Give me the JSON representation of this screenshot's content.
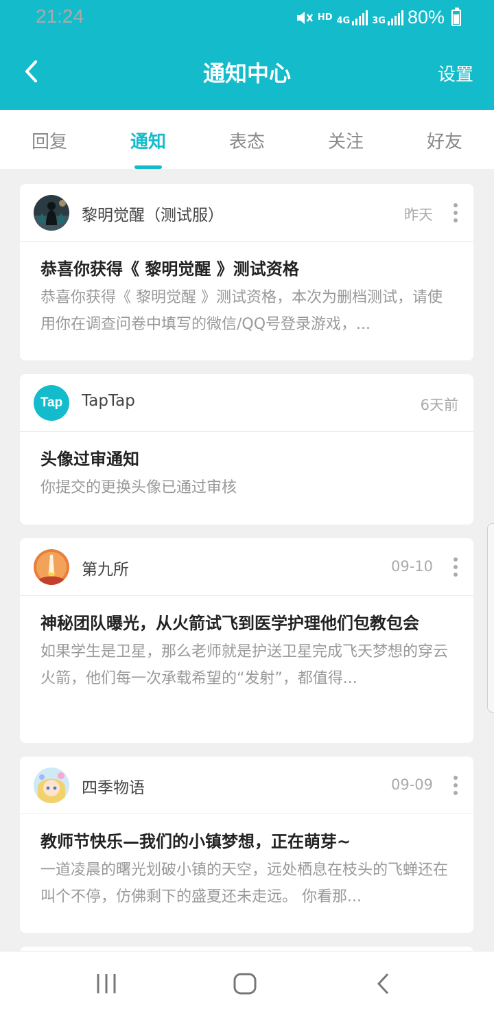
{
  "status_bar": {
    "time": "21:24",
    "icons": [
      "mute-icon",
      "hd-icon",
      "4g-signal-icon",
      "3g-signal-icon",
      "battery-icon"
    ],
    "hd": "HD",
    "net1": "4G",
    "net2": "3G",
    "battery": "80%"
  },
  "appbar": {
    "title": "通知中心",
    "settings": "设置"
  },
  "tabs": [
    {
      "label": "回复"
    },
    {
      "label": "通知"
    },
    {
      "label": "表态"
    },
    {
      "label": "关注"
    },
    {
      "label": "好友"
    }
  ],
  "active_tab": "通知",
  "notifications": [
    {
      "sender": "黎明觉醒（测试服）",
      "time": "昨天",
      "title": "恭喜你获得《 黎明觉醒 》测试资格",
      "text": "恭喜你获得《 黎明觉醒 》测试资格，本次为删档测试，请使用你在调查问卷中填写的微信/QQ号登录游戏，..."
    },
    {
      "sender": "TapTap",
      "time": "6天前",
      "avatar_text": "Tap",
      "title": "头像过审通知",
      "text": "你提交的更换头像已通过审核"
    },
    {
      "sender": "第九所",
      "time": "09-10",
      "title": "神秘团队曝光，从火箭试飞到医学护理他们包教包会",
      "text": "如果学生是卫星，那么老师就是护送卫星完成飞天梦想的穿云火箭，他们每一次承载希望的“发射”，都值得..."
    },
    {
      "sender": "四季物语",
      "time": "09-09",
      "title": "教师节快乐—我们的小镇梦想，正在萌芽~",
      "text": "一道凌晨的曙光划破小镇的天空，远处栖息在枝头的飞蝉还在叫个不停，仿佛剩下的盛夏还未走远。 你看那..."
    }
  ],
  "colors": {
    "accent": "#14bccb",
    "background": "#f0f0f0"
  }
}
